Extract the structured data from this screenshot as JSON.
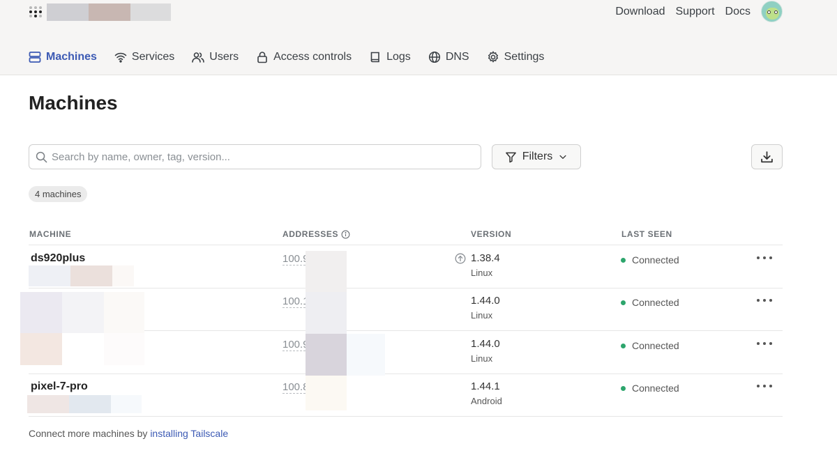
{
  "header": {
    "logo_icon": "tailscale-logo-icon",
    "links": {
      "download": "Download",
      "support": "Support",
      "docs": "Docs"
    }
  },
  "tabs": [
    {
      "label": "Machines",
      "icon": "server-icon",
      "active": true
    },
    {
      "label": "Services",
      "icon": "wifi-icon",
      "active": false
    },
    {
      "label": "Users",
      "icon": "users-icon",
      "active": false
    },
    {
      "label": "Access controls",
      "icon": "lock-icon",
      "active": false
    },
    {
      "label": "Logs",
      "icon": "book-icon",
      "active": false
    },
    {
      "label": "DNS",
      "icon": "globe-icon",
      "active": false
    },
    {
      "label": "Settings",
      "icon": "gear-icon",
      "active": false
    }
  ],
  "page": {
    "title": "Machines"
  },
  "search": {
    "placeholder": "Search by name, owner, tag, version...",
    "value": ""
  },
  "toolbar": {
    "filters_label": "Filters",
    "export_icon": "download-icon"
  },
  "count_badge": "4 machines",
  "table": {
    "headers": {
      "machine": "MACHINE",
      "addresses": "ADDRESSES",
      "version": "VERSION",
      "last_seen": "LAST SEEN"
    },
    "rows": [
      {
        "name": "ds920plus",
        "address": "100.9",
        "version": "1.38.4",
        "os": "Linux",
        "status": "Connected",
        "update_available": true
      },
      {
        "name": "",
        "address": "100.1",
        "version": "1.44.0",
        "os": "Linux",
        "status": "Connected",
        "update_available": false
      },
      {
        "name": "",
        "address": "100.9",
        "version": "1.44.0",
        "os": "Linux",
        "status": "Connected",
        "update_available": false
      },
      {
        "name": "pixel-7-pro",
        "address": "100.8",
        "version": "1.44.1",
        "os": "Android",
        "status": "Connected",
        "update_available": false
      }
    ]
  },
  "footer": {
    "text": "Connect more machines by ",
    "link": "installing Tailscale"
  },
  "colors": {
    "accent": "#3c5ab4",
    "connected": "#2da56c",
    "header_bg": "#f6f5f4"
  }
}
